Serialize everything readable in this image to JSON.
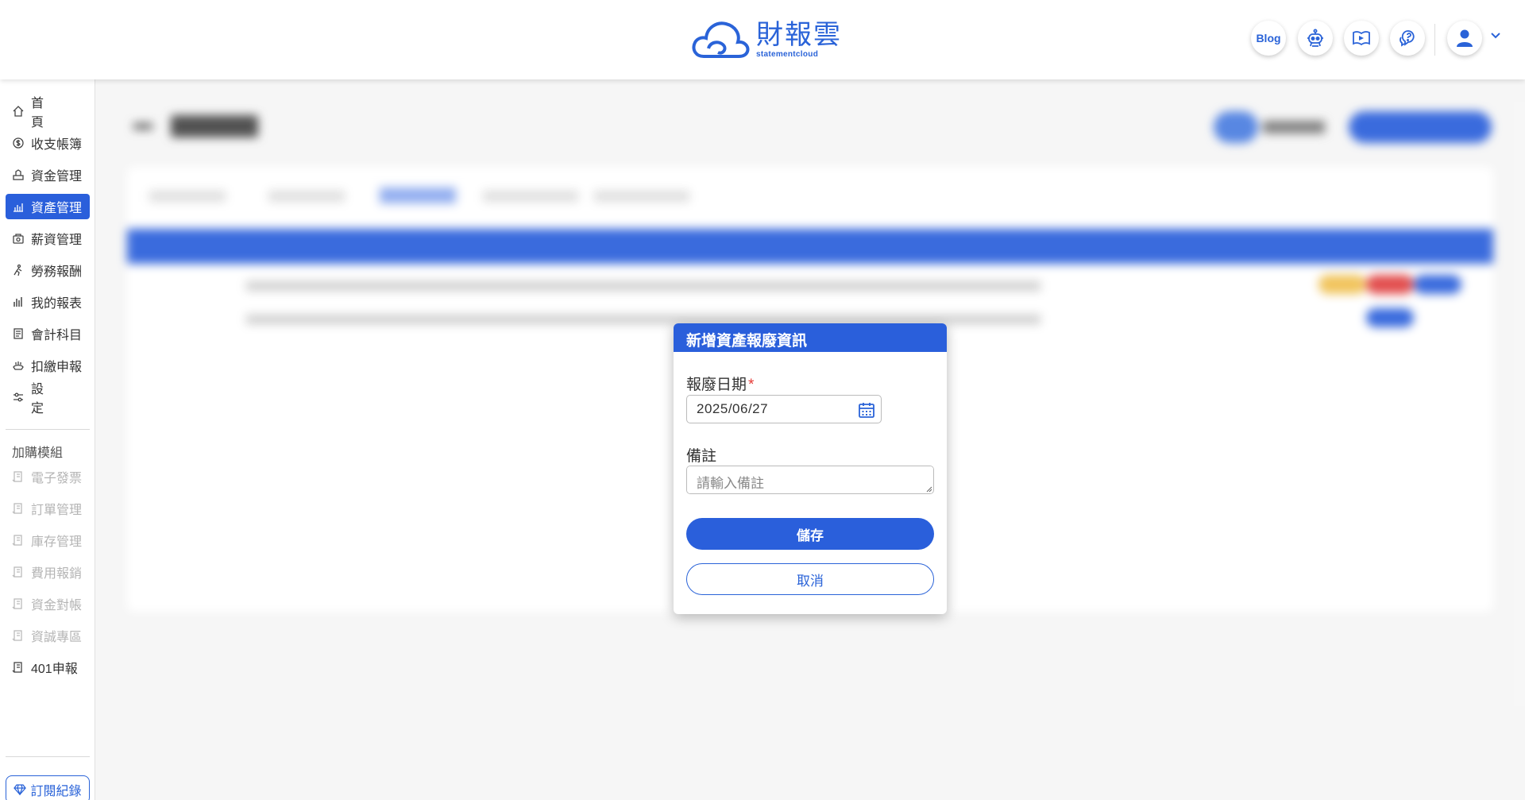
{
  "header": {
    "logo_cn": "財報雲",
    "logo_en": "statementcloud",
    "blog_label": "Blog",
    "icons": [
      "robot-icon",
      "video-book-icon",
      "help-chat-icon",
      "user-icon",
      "chevron-down-icon"
    ]
  },
  "sidebar": {
    "items": [
      {
        "label": "首頁",
        "icon": "home-icon"
      },
      {
        "label": "收支帳簿",
        "icon": "money-icon"
      },
      {
        "label": "資金管理",
        "icon": "funds-icon"
      },
      {
        "label": "資產管理",
        "icon": "assets-icon",
        "active": true
      },
      {
        "label": "薪資管理",
        "icon": "salary-icon"
      },
      {
        "label": "勞務報酬",
        "icon": "labor-icon"
      },
      {
        "label": "我的報表",
        "icon": "chart-icon"
      },
      {
        "label": "會計科目",
        "icon": "accounts-icon"
      },
      {
        "label": "扣繳申報",
        "icon": "withholding-icon"
      },
      {
        "label": "設定",
        "icon": "settings-icon"
      }
    ],
    "addon_heading": "加購模組",
    "addon_items": [
      {
        "label": "電子發票",
        "enabled": false
      },
      {
        "label": "訂單管理",
        "enabled": false
      },
      {
        "label": "庫存管理",
        "enabled": false
      },
      {
        "label": "費用報銷",
        "enabled": false
      },
      {
        "label": "資金對帳",
        "enabled": false
      },
      {
        "label": "資誠專區",
        "enabled": false
      },
      {
        "label": "401申報",
        "enabled": true
      }
    ],
    "subscription_label": "訂閱紀錄"
  },
  "dialog": {
    "title": "新增資產報廢資訊",
    "date_label": "報廢日期",
    "required_mark": "*",
    "date_value": "2025/06/27",
    "note_label": "備註",
    "note_placeholder": "請輸入備註",
    "save_label": "儲存",
    "cancel_label": "取消"
  },
  "colors": {
    "primary": "#2a5fdb",
    "required": "#e53935",
    "disabled": "#b4b4b4"
  }
}
